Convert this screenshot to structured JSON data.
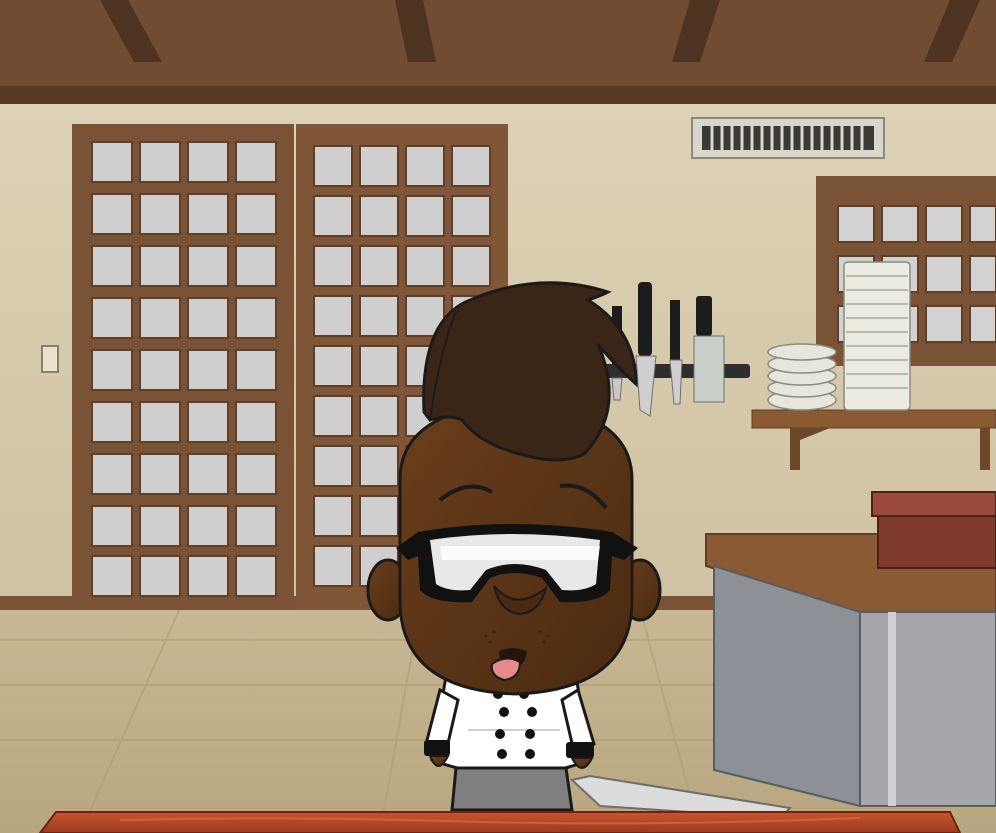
{
  "scene": {
    "type": "cooking-game-kitchen",
    "description_visible_text": "",
    "colors": {
      "wall": "#d9cdb0",
      "ceiling": "#6d4a30",
      "wood": "#7a5236",
      "floor": "#c6b48f",
      "counter_top": "#8a5a34",
      "counter_side": "#9a9a9e",
      "skin": "#5a3416",
      "hair": "#3a2516",
      "chef_coat": "#ffffff",
      "cutting_board": "#b84a2a"
    },
    "character": {
      "expression": "tired",
      "outfit": "chef-coat",
      "eyewear": "safety-goggles"
    }
  }
}
